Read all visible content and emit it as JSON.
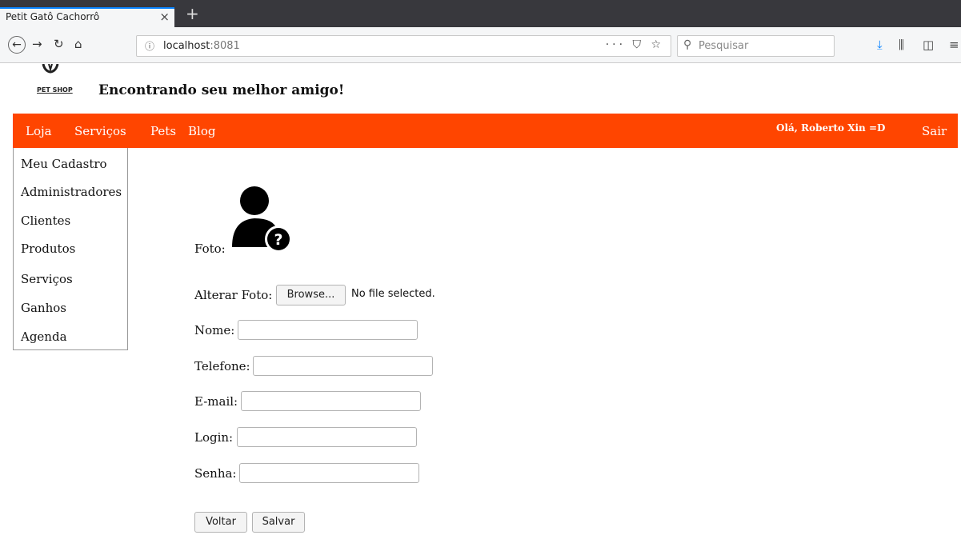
{
  "browser": {
    "tab_title": "Petit Gatô Cachorrô",
    "tab_close": "×",
    "new_tab": "+",
    "url_host": "localhost",
    "url_port": ":8081",
    "url_actions": "··· ⛉ ☆",
    "search_placeholder": "Pesquisar"
  },
  "header": {
    "logo_text": "PET SHOP",
    "tagline": "Encontrando seu melhor amigo!"
  },
  "menu": {
    "items": [
      "Loja",
      "Serviços",
      "Pets",
      "Blog"
    ],
    "greeting": "Olá, Roberto Xin =D",
    "logout": "Sair",
    "accent_color": "#ff4500"
  },
  "dropdown": {
    "items": [
      "Meu Cadastro",
      "Administradores",
      "Clientes",
      "Produtos",
      "Serviços",
      "Ganhos",
      "Agenda"
    ]
  },
  "form": {
    "photo_label": "Foto:",
    "change_photo_label": "Alterar Foto:",
    "browse_button": "Browse...",
    "file_status": "No file selected.",
    "name_label": "Nome:",
    "name_value": "",
    "phone_label": "Telefone:",
    "phone_value": "",
    "email_label": "E-mail:",
    "email_value": "",
    "login_label": "Login:",
    "login_value": "",
    "password_label": "Senha:",
    "password_value": "",
    "back_button": "Voltar",
    "save_button": "Salvar"
  }
}
